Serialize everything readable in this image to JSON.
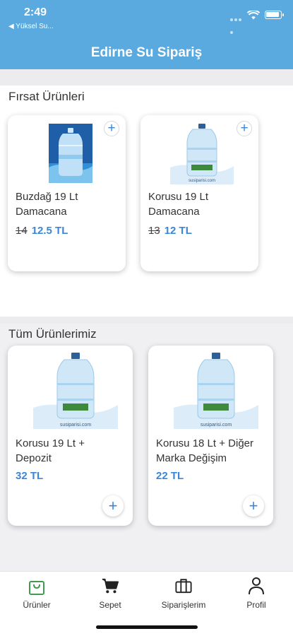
{
  "status": {
    "time": "2:49",
    "back_label": "◀ Yüksel Su..."
  },
  "app": {
    "title": "Edirne Su Sipariş",
    "brand_color": "#5aa9df",
    "accent_color": "#3a86d8"
  },
  "deals": {
    "title": "Fırsat Ürünleri",
    "products": [
      {
        "name_line1": "Buzdağ 19 Lt",
        "name_line2": "Damacana",
        "old_price": "14",
        "price": "12.5 TL"
      },
      {
        "name_line1": "Korusu 19 Lt",
        "name_line2": "Damacana",
        "old_price": "13",
        "price": "12 TL"
      }
    ]
  },
  "all": {
    "title": "Tüm Ürünlerimiz",
    "products": [
      {
        "name_line1": "Korusu 19 Lt +",
        "name_line2": "Depozit",
        "price": "32 TL"
      },
      {
        "name_line1": "Korusu 18 Lt + Diğer",
        "name_line2": "Marka Değişim",
        "price": "22 TL"
      }
    ]
  },
  "tabs": [
    {
      "label": "Ürünler",
      "icon": "bag-icon",
      "active": true
    },
    {
      "label": "Sepet",
      "icon": "cart-icon"
    },
    {
      "label": "Siparişlerim",
      "icon": "briefcase-icon"
    },
    {
      "label": "Profil",
      "icon": "person-icon"
    }
  ]
}
